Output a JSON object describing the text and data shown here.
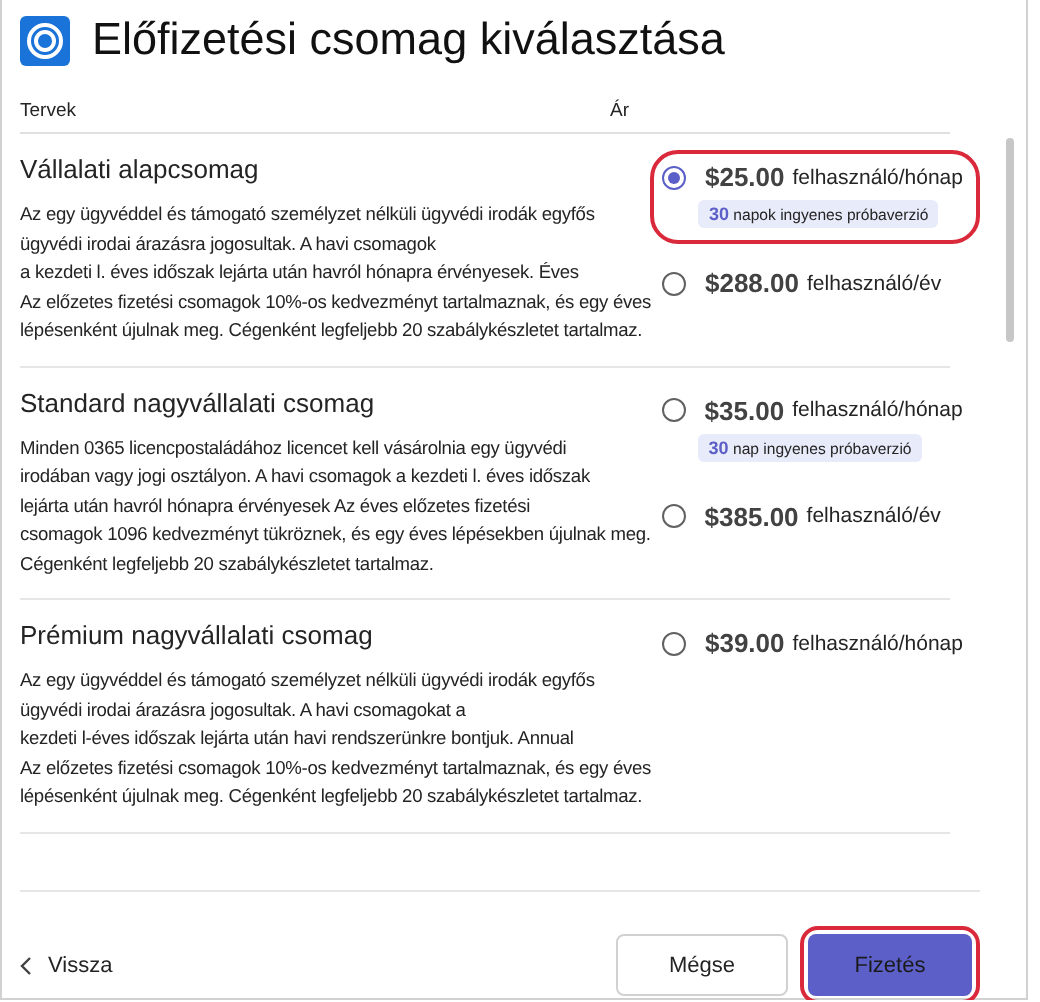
{
  "window": {
    "title": "Előfizetési csomag kiválasztása"
  },
  "columns": [
    "Tervek",
    "Ár"
  ],
  "plans": [
    {
      "name": "Vállalati alapcsomag",
      "description": [
        "Az egy ügyvéddel és támogató személyzet nélküli ügyvédi irodák egyfős",
        "ügyvédi irodai árazásra jogosultak. A havi csomagok",
        "a kezdeti l. éves időszak lejárta után havról hónapra érvényesek. Éves",
        "Az előzetes fizetési csomagok 10%-os kedvezményt tartalmaznak, és egy éves",
        "lépésenként újulnak meg. Cégenként legfeljebb 20 szabálykészletet tartalmaz."
      ],
      "options": [
        {
          "price": "$25.00",
          "unit": "felhasználó/hónap",
          "selected": true,
          "highlighted": true,
          "trial": {
            "number": "30",
            "text": "napok ingyenes próbaverzió"
          }
        },
        {
          "price": "$288.00",
          "unit": "felhasználó/év",
          "selected": false,
          "highlighted": false
        }
      ]
    },
    {
      "name": "Standard nagyvállalati csomag",
      "description": [
        "Minden 0365 licencpostaládához licencet kell vásárolnia egy ügyvédi",
        "irodában vagy jogi osztályon. A havi csomagok a kezdeti l. éves időszak",
        "lejárta után havról hónapra érvényesek Az éves előzetes fizetési",
        "csomagok 1096 kedvezményt tükröznek, és egy éves lépésekben újulnak meg.",
        "Cégenként legfeljebb 20 szabálykészletet tartalmaz."
      ],
      "options": [
        {
          "price": "$35.00",
          "unit": "felhasználó/hónap",
          "selected": false,
          "highlighted": false,
          "trial": {
            "number": "30",
            "text": "nap ingyenes próbaverzió"
          }
        },
        {
          "price": "$385.00",
          "unit": "felhasználó/év",
          "selected": false,
          "highlighted": false
        }
      ]
    },
    {
      "name": "Prémium nagyvállalati csomag",
      "description": [
        "Az egy ügyvéddel és támogató személyzet nélküli ügyvédi irodák egyfős",
        "ügyvédi irodai árazásra jogosultak. A havi csomagokat a",
        "kezdeti l-éves időszak lejárta után havi rendszerünkre bontjuk. Annual",
        "Az előzetes fizetési csomagok 10%-os kedvezményt tartalmaznak, és egy éves",
        "lépésenként újulnak meg. Cégenként legfeljebb 20 szabálykészletet tartalmaz."
      ],
      "options": [
        {
          "price": "$39.00",
          "unit": "felhasználó/hónap",
          "selected": false,
          "highlighted": false
        }
      ]
    }
  ],
  "footer": {
    "back": "Vissza",
    "buttons": [
      {
        "label": "Mégse",
        "kind": "secondary",
        "highlighted": false
      },
      {
        "label": "Fizetés",
        "kind": "primary",
        "highlighted": true
      }
    ]
  }
}
